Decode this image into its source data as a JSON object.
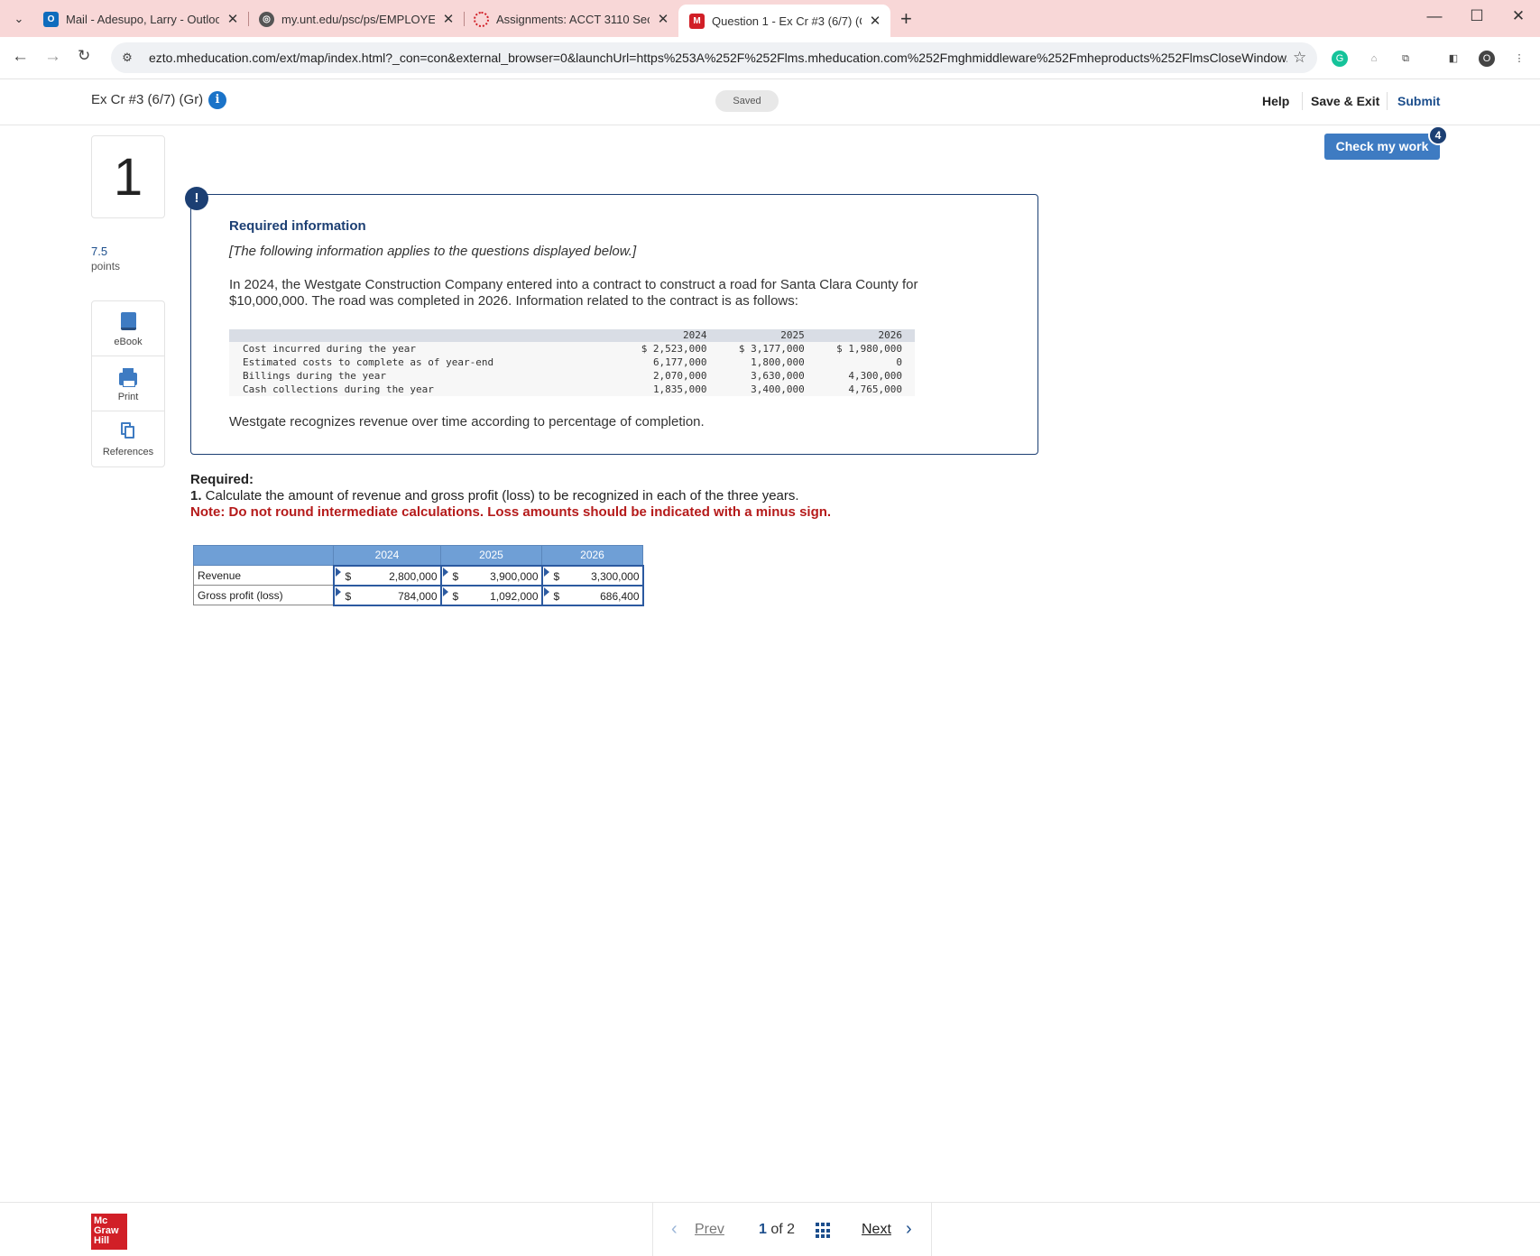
{
  "browser": {
    "tabs": [
      {
        "title": "Mail - Adesupo, Larry - Outlook",
        "favicon": "outlook-icon",
        "color": "#0f6cbd"
      },
      {
        "title": "my.unt.edu/psc/ps/EMPLOYEE/",
        "favicon": "globe-icon",
        "color": "#555555"
      },
      {
        "title": "Assignments: ACCT 3110 Sectio",
        "favicon": "spinner-icon",
        "color": "#d11f27"
      },
      {
        "title": "Question 1 - Ex Cr #3 (6/7) (Gr)",
        "favicon": "mcgraw-m-icon",
        "color": "#d11f27"
      }
    ],
    "url": "ezto.mheducation.com/ext/map/index.html?_con=con&external_browser=0&launchUrl=https%253A%252F%252Flms.mheducation.com%252Fmghmiddleware%252Fmheproducts%252FlmsCloseWindow....",
    "profile_initial": "O"
  },
  "header": {
    "assignment_title": "Ex Cr #3 (6/7) (Gr)",
    "saved_label": "Saved",
    "help": "Help",
    "save_exit": "Save & Exit",
    "submit": "Submit",
    "check_my_work": "Check my work",
    "check_badge": "4"
  },
  "question": {
    "number": "1",
    "points": "7.5",
    "points_label": "points",
    "tools": [
      "eBook",
      "Print",
      "References"
    ]
  },
  "required_info": {
    "alert": "!",
    "title": "Required information",
    "subtitle": "[The following information applies to the questions displayed below.]",
    "paragraph": "In 2024, the Westgate Construction Company entered into a contract to construct a road for Santa Clara County for $10,000,000. The road was completed in 2026. Information related to the contract is as follows:",
    "table": {
      "years": [
        "2024",
        "2025",
        "2026"
      ],
      "rows": [
        {
          "label": "Cost incurred during the year",
          "values": [
            "$ 2,523,000",
            "$ 3,177,000",
            "$ 1,980,000"
          ]
        },
        {
          "label": "Estimated costs to complete as of year-end",
          "values": [
            "6,177,000",
            "1,800,000",
            "0"
          ]
        },
        {
          "label": "Billings during the year",
          "values": [
            "2,070,000",
            "3,630,000",
            "4,300,000"
          ]
        },
        {
          "label": "Cash collections during the year",
          "values": [
            "1,835,000",
            "3,400,000",
            "4,765,000"
          ]
        }
      ]
    },
    "footer": "Westgate recognizes revenue over time according to percentage of completion."
  },
  "required": {
    "heading": "Required:",
    "item_num": "1.",
    "item_text": " Calculate the amount of revenue and gross profit (loss) to be recognized in each of the three years.",
    "note": "Note: Do not round intermediate calculations. Loss amounts should be indicated with a minus sign."
  },
  "answer": {
    "years": [
      "2024",
      "2025",
      "2026"
    ],
    "currency": "$",
    "rows": [
      {
        "label": "Revenue",
        "values": [
          "2,800,000",
          "3,900,000",
          "3,300,000"
        ]
      },
      {
        "label": "Gross profit (loss)",
        "values": [
          "784,000",
          "1,092,000",
          "686,400"
        ]
      }
    ]
  },
  "footer": {
    "logo_lines": [
      "Mc",
      "Graw",
      "Hill"
    ],
    "prev": "Prev",
    "current": "1",
    "of": "of",
    "total": "2",
    "next": "Next"
  }
}
